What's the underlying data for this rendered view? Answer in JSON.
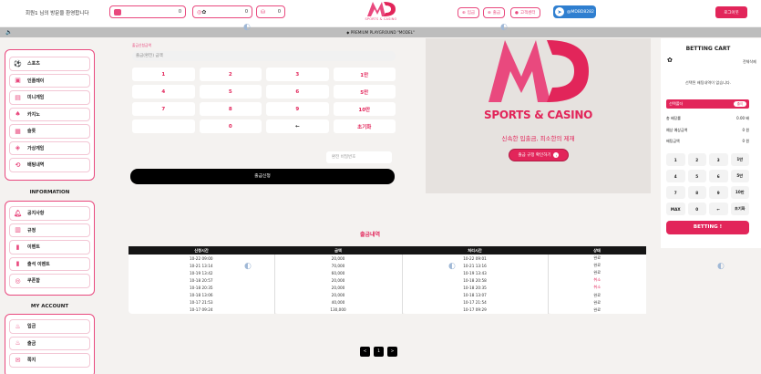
{
  "header": {
    "welcome": "회원1 님의 방문을 환영합니다",
    "wallets": [
      {
        "icon": "wallet-icon",
        "value": "0"
      },
      {
        "icon": "coin-icon",
        "value": "0"
      },
      {
        "icon": "point-icon",
        "value": "0"
      }
    ],
    "logo_text": "SPORTS & CASINO",
    "deposit_label": "입금",
    "withdraw_label": "출금",
    "support_label": "고객센터",
    "telegram_label": "@MDBD8282",
    "login_label": "로그아웃"
  },
  "marquee": "◆ PREMIUM PLAYGROUND \"MODEL\"",
  "sidebar": {
    "games": [
      {
        "icon": "soccer-icon",
        "label": "스포츠"
      },
      {
        "icon": "live-icon",
        "label": "인플레이"
      },
      {
        "icon": "minigame-icon",
        "label": "미니게임"
      },
      {
        "icon": "casino-icon",
        "label": "카지노"
      },
      {
        "icon": "slot-icon",
        "label": "슬롯"
      },
      {
        "icon": "virtual-icon",
        "label": "가상게임"
      },
      {
        "icon": "history-icon",
        "label": "배팅내역"
      }
    ],
    "info_title": "INFORMATION",
    "info": [
      {
        "icon": "bell-icon",
        "label": "공지사항"
      },
      {
        "icon": "rule-icon",
        "label": "규정"
      },
      {
        "icon": "gift-icon",
        "label": "이벤트"
      },
      {
        "icon": "attendance-icon",
        "label": "출석 이벤트"
      },
      {
        "icon": "coupon-icon",
        "label": "쿠폰함"
      }
    ],
    "account_title": "MY ACCOUNT",
    "account": [
      {
        "icon": "deposit-icon",
        "label": "입금"
      },
      {
        "icon": "withdraw-icon",
        "label": "출금"
      },
      {
        "icon": "message-icon",
        "label": "쪽지"
      }
    ]
  },
  "withdraw": {
    "amount_label": "출금신청금액",
    "amount_placeholder": "출금(환전) 금액",
    "keys": [
      [
        "1",
        "2",
        "3",
        "1만"
      ],
      [
        "4",
        "5",
        "6",
        "5만"
      ],
      [
        "7",
        "8",
        "9",
        "10만"
      ],
      [
        "",
        "0",
        "←",
        "초기화"
      ]
    ],
    "password_placeholder": "환전 비밀번호",
    "submit_label": "출금신청"
  },
  "banner": {
    "title": "SPORTS & CASINO",
    "subtitle": "신속한 입출금, 최소한의 제재",
    "button_label": "출금 규정 확인하기"
  },
  "history": {
    "title": "출금내역",
    "columns": [
      "신청시간",
      "금액",
      "처리시간",
      "상태"
    ],
    "rows": [
      [
        "10-22 09:00",
        "20,000",
        "10-22 09:01",
        "완료"
      ],
      [
        "10-21 13:14",
        "70,000",
        "10-21 13:16",
        "완료"
      ],
      [
        "10-19 13:42",
        "60,000",
        "10-19 13:43",
        "완료"
      ],
      [
        "10-18 20:57",
        "20,000",
        "10-18 20:58",
        "취소"
      ],
      [
        "10-18 20:35",
        "20,000",
        "10-18 20:35",
        "취소"
      ],
      [
        "10-18 13:06",
        "20,000",
        "10-18 13:07",
        "완료"
      ],
      [
        "10-17 21:53",
        "40,000",
        "10-17 21:54",
        "완료"
      ],
      [
        "10-17 09:24",
        "130,000",
        "10-17 09:29",
        "완료"
      ]
    ],
    "cancel_color": "#e2255a",
    "pager": [
      "<",
      "1",
      ">"
    ]
  },
  "cart": {
    "title": "BETTING CART",
    "clear_label": "전체삭제",
    "empty_text": "선택된 배팅내역이 없습니다.",
    "bar_label": "선택폴더",
    "toggle_label": "줄이",
    "rows": [
      {
        "label": "총 배당률",
        "value": "0.00 배"
      },
      {
        "label": "예상 예상금액",
        "value": "0 원"
      },
      {
        "label": "배팅금액",
        "value": "0 원"
      }
    ],
    "keys": [
      [
        "1",
        "2",
        "3",
        "1만"
      ],
      [
        "4",
        "5",
        "6",
        "5만"
      ],
      [
        "7",
        "8",
        "9",
        "10만"
      ],
      [
        "MAX",
        "0",
        "←",
        "초기화"
      ]
    ],
    "bet_label": "BETTING !"
  },
  "colors": {
    "accent": "#e2255a",
    "telegram": "#2f7fd0"
  }
}
